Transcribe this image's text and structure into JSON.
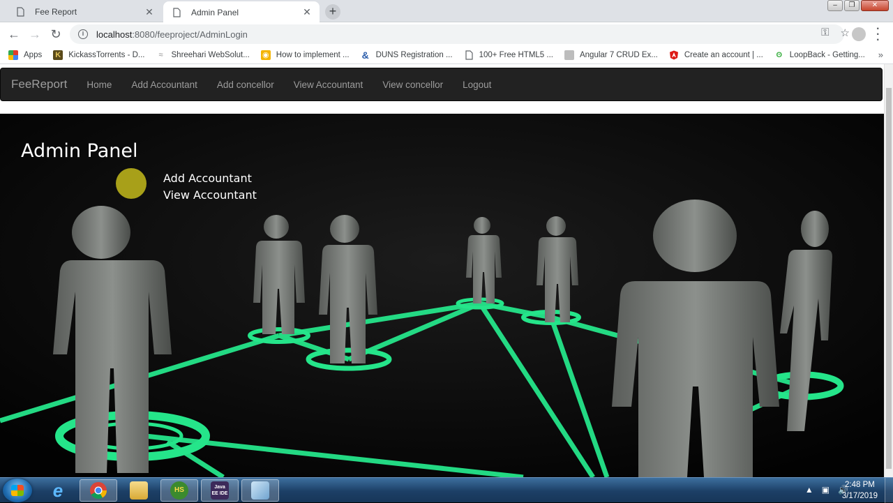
{
  "browser": {
    "tabs": [
      {
        "title": "Fee Report",
        "active": false
      },
      {
        "title": "Admin Panel",
        "active": true
      }
    ],
    "address": {
      "host": "localhost",
      "path": ":8080/feeproject/AdminLogin"
    },
    "bookmarks": [
      {
        "label": "Apps",
        "icon": "apps-grid-icon",
        "color": "#e33b2e"
      },
      {
        "label": "KickassTorrents - D...",
        "icon": "kickass-icon",
        "color": "#5a4a1a"
      },
      {
        "label": "Shreehari WebSolut...",
        "icon": "shreehari-icon",
        "color": "#b0b0b0"
      },
      {
        "label": "How to implement ...",
        "icon": "bookmark-icon",
        "color": "#f4b400"
      },
      {
        "label": "DUNS Registration ...",
        "icon": "duns-icon",
        "color": "#2a5caa"
      },
      {
        "label": "100+ Free HTML5 ...",
        "icon": "page-icon",
        "color": "#5f6368"
      },
      {
        "label": "Angular 7 CRUD Ex...",
        "icon": "angular-site-icon",
        "color": "#9a9a9a"
      },
      {
        "label": "Create an account | ...",
        "icon": "angular-icon",
        "color": "#dd1b16"
      },
      {
        "label": "LoopBack - Getting...",
        "icon": "loopback-icon",
        "color": "#3cb043"
      }
    ]
  },
  "navbar": {
    "brand": "FeeReport",
    "links": [
      "Home",
      "Add Accountant",
      "Add concellor",
      "View Accountant",
      "View concellor",
      "Logout"
    ]
  },
  "hero": {
    "title": "Admin Panel",
    "links": [
      "Add Accountant",
      "View Accountant"
    ]
  },
  "taskbar": {
    "time": "2:48 PM",
    "date": "3/17/2019",
    "apps": [
      {
        "name": "ie",
        "label": "e",
        "color": "#1e8ad6"
      },
      {
        "name": "chrome",
        "label": "",
        "color": "#dd4b39"
      },
      {
        "name": "explorer",
        "label": "",
        "color": "#e8c25a"
      },
      {
        "name": "hs",
        "label": "HS",
        "color": "#3b8a2e"
      },
      {
        "name": "java-ee",
        "label": "Java EE IDE",
        "color": "#3c2a5a"
      },
      {
        "name": "app6",
        "label": "",
        "color": "#7fb1d8"
      }
    ]
  },
  "colors": {
    "navbar_bg": "#222222",
    "navbar_text": "#9d9d9d",
    "glow": "#25e58a"
  }
}
